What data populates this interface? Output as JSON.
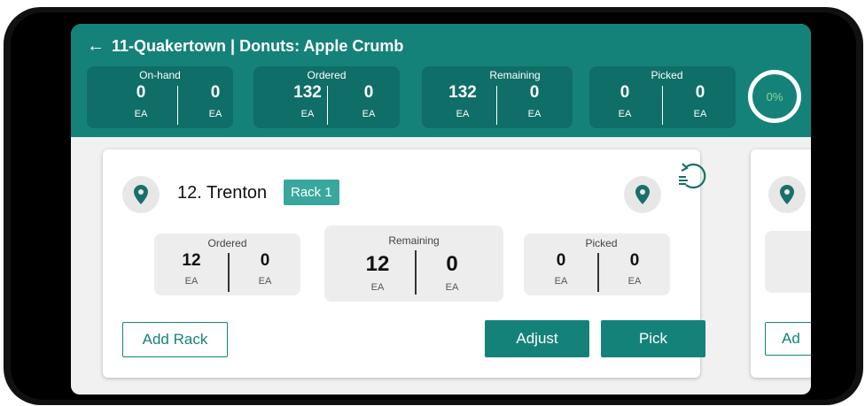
{
  "header": {
    "title": "11-Quakertown | Donuts: Apple Crumb",
    "summary": [
      {
        "label": "On-hand",
        "left": "0",
        "right": "0",
        "unit_left": "EA",
        "unit_right": "EA"
      },
      {
        "label": "Ordered",
        "left": "132",
        "right": "0",
        "unit_left": "EA",
        "unit_right": "EA"
      },
      {
        "label": "Remaining",
        "left": "132",
        "right": "0",
        "unit_left": "EA",
        "unit_right": "EA"
      },
      {
        "label": "Picked",
        "left": "0",
        "right": "0",
        "unit_left": "EA",
        "unit_right": "EA"
      }
    ],
    "progress": "0%"
  },
  "card": {
    "store": "12. Trenton",
    "rack": "Rack 1",
    "ordered": {
      "label": "Ordered",
      "left": "12",
      "right": "0",
      "unit_left": "EA",
      "unit_right": "EA"
    },
    "remaining": {
      "label": "Remaining",
      "left": "12",
      "right": "0",
      "unit_left": "EA",
      "unit_right": "EA"
    },
    "picked": {
      "label": "Picked",
      "left": "0",
      "right": "0",
      "unit_left": "EA",
      "unit_right": "EA"
    },
    "add_rack": "Add Rack",
    "adjust": "Adjust",
    "pick": "Pick"
  },
  "next_card": {
    "add_label": "Ad"
  },
  "colors": {
    "primary": "#15827a",
    "primary_dark": "#0f6e67",
    "badge": "#3aa79e",
    "progress_text": "#8fd88a"
  },
  "icons": [
    "back-arrow-icon",
    "location-pin-icon",
    "reset-list-icon"
  ]
}
